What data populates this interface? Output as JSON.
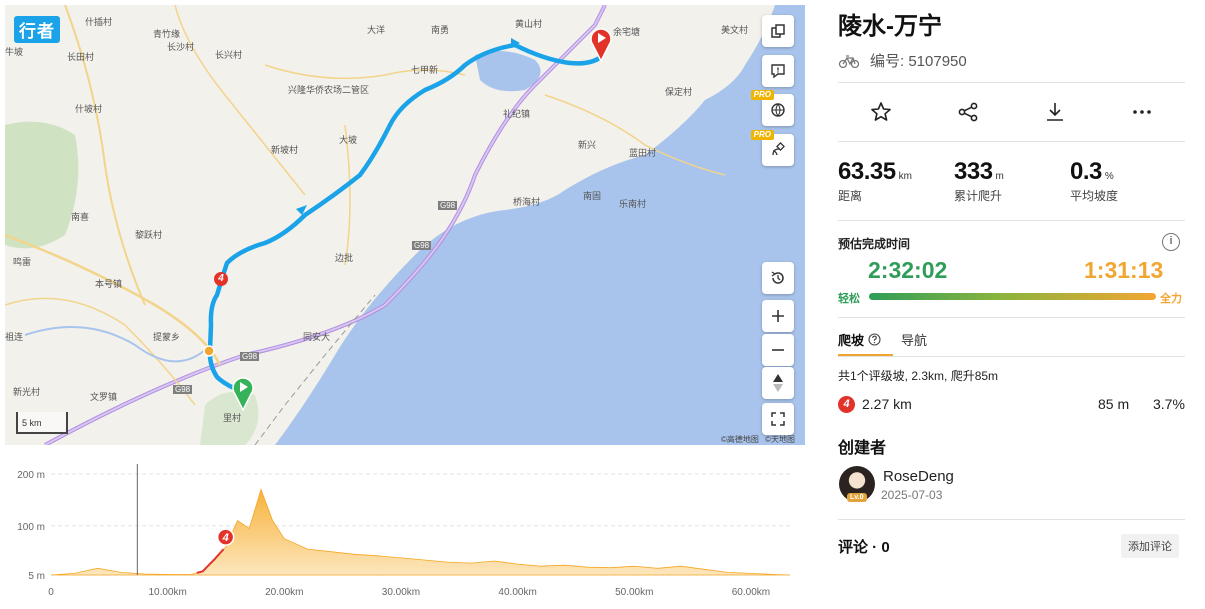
{
  "map": {
    "logo": "行者",
    "scale_label": "5 km",
    "copyright": [
      "©高德地图",
      "©天地图"
    ],
    "pro_badge": "PRO",
    "place_labels": [
      "什插村",
      "青竹缘",
      "长沙村",
      "长兴村",
      "大洋",
      "南勇",
      "黄山村",
      "余宅塘",
      "美文村",
      "长田村",
      "兴隆华侨农场二管区",
      "七甲新",
      "礼纪镇",
      "保定村",
      "什坡村",
      "大坡",
      "新坡村",
      "新兴",
      "蓝田村",
      "南固",
      "乐南村",
      "桥海村",
      "南喜",
      "黎跃村",
      "边批",
      "鸣雷",
      "本号镇",
      "提蒙乡",
      "祖连",
      "新光村",
      "文罗镇",
      "里村",
      "同安大",
      "牛坡",
      "G98",
      "G98",
      "G98",
      "G98"
    ],
    "route_marker_climb": "4",
    "tools": [
      "copy-icon",
      "feedback-icon",
      "map-layer-icon",
      "satellite-icon",
      "history-icon",
      "zoom-in-icon",
      "zoom-out-icon",
      "compass-icon",
      "fullscreen-icon"
    ]
  },
  "elevation": {
    "y_ticks": [
      "200 m",
      "100 m",
      "5 m"
    ],
    "x_ticks": [
      "0",
      "10.00km",
      "20.00km",
      "30.00km",
      "40.00km",
      "50.00km",
      "60.00km"
    ],
    "climb_badge": "4"
  },
  "chart_data": {
    "type": "area",
    "title": "",
    "xlabel": "",
    "ylabel": "",
    "x_unit": "km",
    "y_unit": "m",
    "xlim": [
      0,
      63.35
    ],
    "ylim": [
      5,
      200
    ],
    "x": [
      0,
      2,
      4,
      6,
      8,
      10,
      12,
      13,
      14,
      15,
      16,
      17,
      18,
      19,
      20,
      22,
      24,
      26,
      28,
      30,
      32,
      34,
      36,
      38,
      40,
      42,
      44,
      46,
      48,
      50,
      52,
      54,
      56,
      58,
      60,
      62,
      63.35
    ],
    "y": [
      5,
      8,
      18,
      10,
      7,
      6,
      6,
      12,
      35,
      60,
      110,
      95,
      170,
      110,
      75,
      55,
      50,
      45,
      42,
      38,
      34,
      30,
      28,
      32,
      26,
      22,
      24,
      20,
      19,
      22,
      18,
      22,
      16,
      10,
      8,
      6,
      5
    ],
    "climb_segment_x": [
      12.5,
      14.8
    ],
    "cursor_x": 7.4
  },
  "panel": {
    "title": "陵水-万宁",
    "id_label": "编号:",
    "id_value": "5107950",
    "stats": [
      {
        "value": "63.35",
        "unit": "km",
        "label": "距离"
      },
      {
        "value": "333",
        "unit": "m",
        "label": "累计爬升"
      },
      {
        "value": "0.3",
        "unit": "%",
        "label": "平均坡度"
      }
    ],
    "eta_title": "预估完成时间",
    "eta_easy": "2:32:02",
    "eta_hard": "1:31:13",
    "easy_label": "轻松",
    "hard_label": "全力",
    "tab_climb": "爬坡",
    "tab_nav": "导航",
    "climb_summary": "共1个评级坡, 2.3km, 爬升85m",
    "climb_badge": "4",
    "climb_distance": "2.27 km",
    "climb_height": "85 m",
    "climb_grade": "3.7%",
    "creator_title": "创建者",
    "creator_name": "RoseDeng",
    "creator_level": "Lv.0",
    "creator_date": "2025-07-03",
    "comments_label": "评论 · 0",
    "add_comment_label": "添加评论"
  }
}
